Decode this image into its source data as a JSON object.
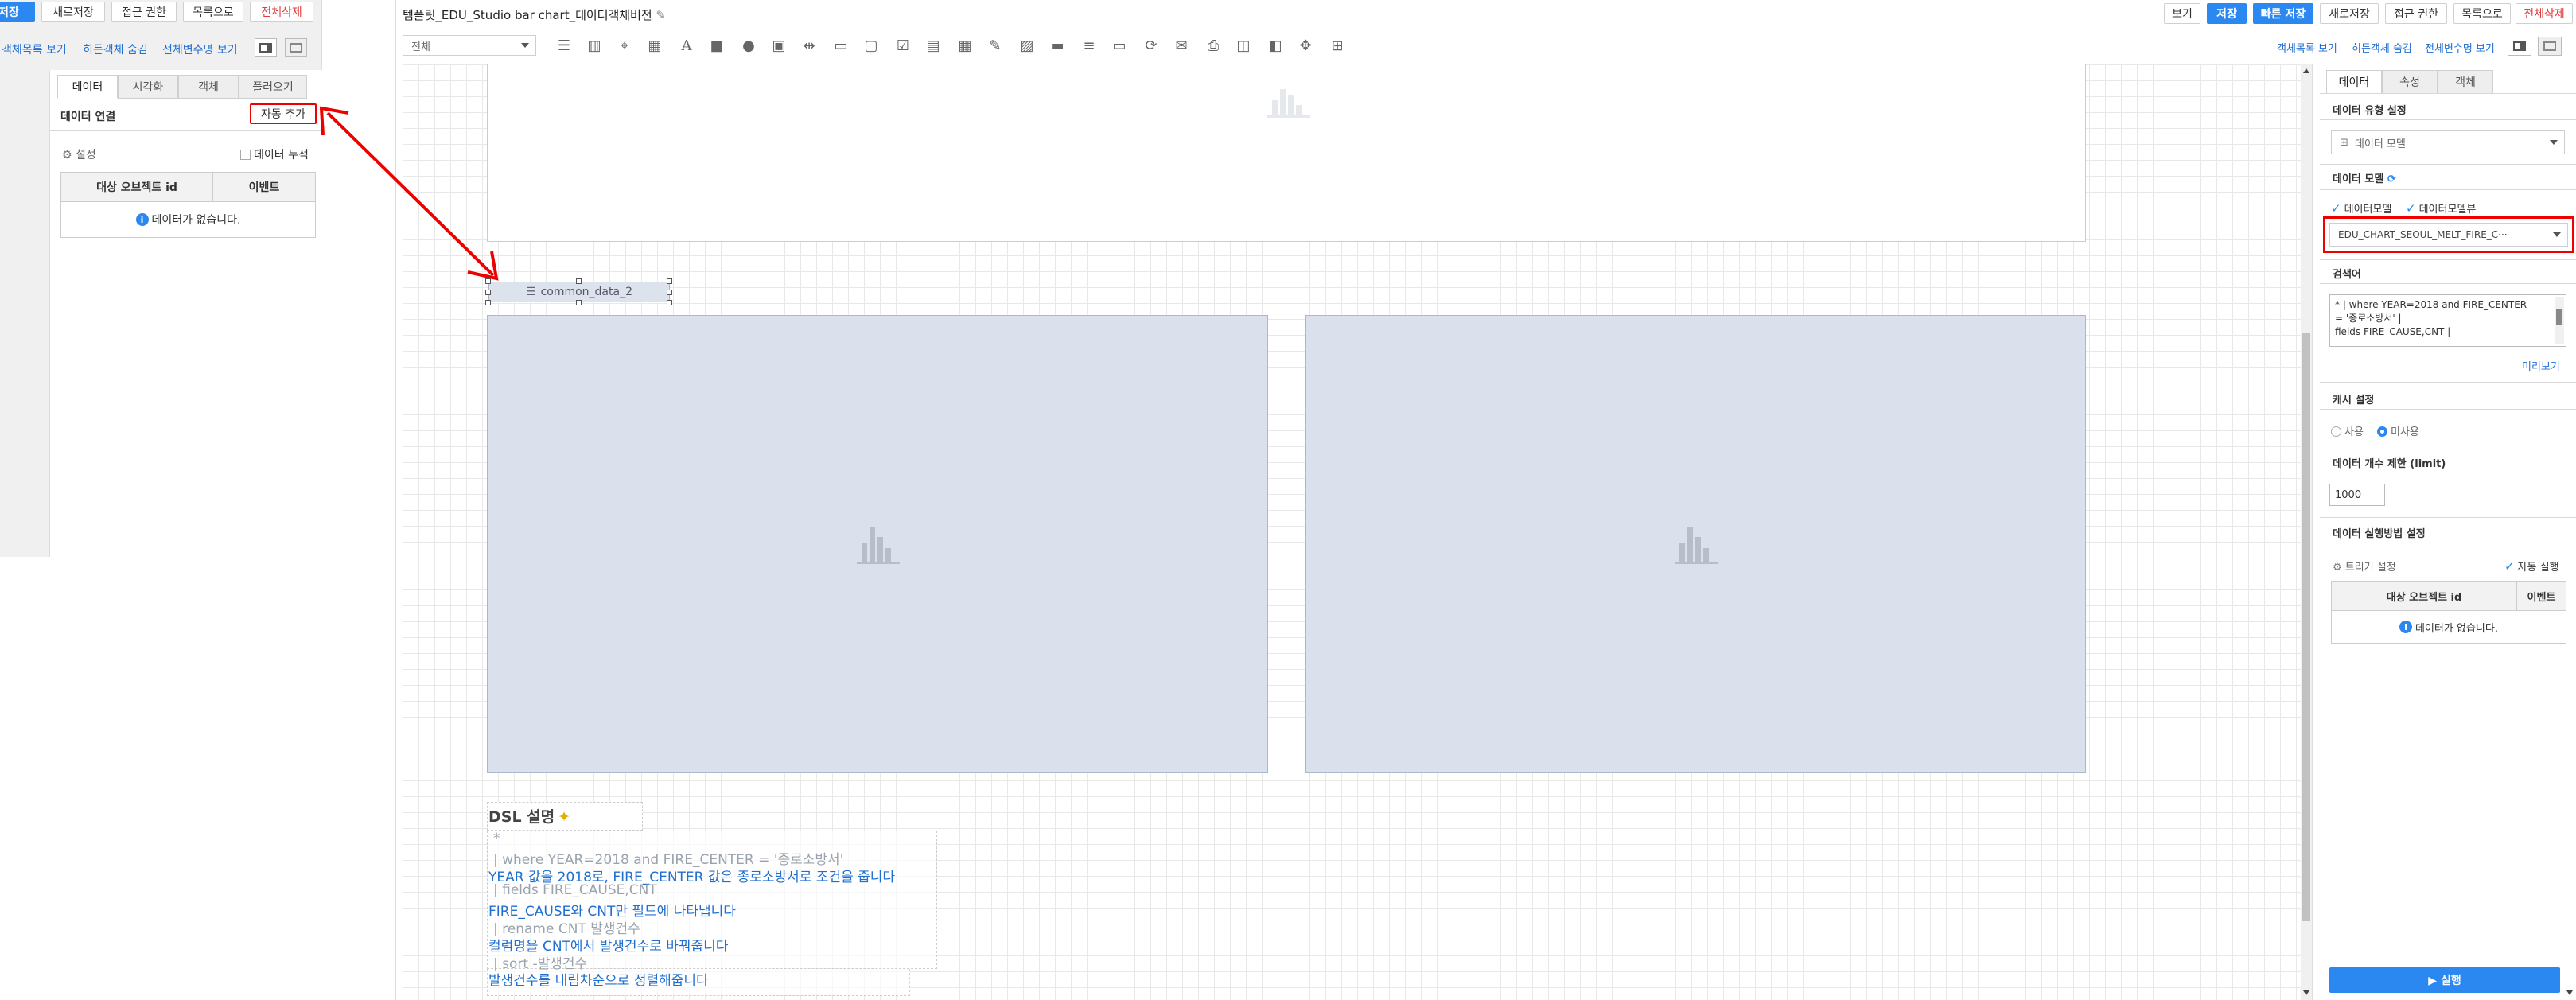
{
  "left_panel": {
    "toolbar": {
      "save_label": "저장",
      "save_as_label": "새로저장",
      "access_label": "접근 권한",
      "list_label": "목록으로",
      "delete_all_label": "전체삭제"
    },
    "links": {
      "object_list": "객체목록 보기",
      "hidden_objects": "히든객체 숨김",
      "all_vars": "전체변수명 보기"
    },
    "tabs": [
      "데이터",
      "시각화",
      "객체",
      "플러오기"
    ],
    "section_title": "데이터 연결",
    "auto_add_label": "자동 추가",
    "settings_label": "설정",
    "accumulate_label": "데이터 누적",
    "table": {
      "col1": "대상 오브젝트 id",
      "col2": "이벤트",
      "empty": "데이터가 없습니다."
    }
  },
  "header": {
    "title": "템플릿_EDU_Studio bar chart_데이터객체버전",
    "buttons": {
      "view": "보기",
      "save": "저장",
      "quick_save": "빠른 저장",
      "save_as": "새로저장",
      "access": "접근 권한",
      "list": "목록으로",
      "delete_all": "전체삭제"
    },
    "links": {
      "object_list": "객체목록 보기",
      "hidden_objects": "히든객체 숨김",
      "all_vars": "전체변수명 보기"
    },
    "filter_value": "전체"
  },
  "canvas": {
    "data_object_label": "common_data_2",
    "dsl": {
      "title": "DSL 설명",
      "lines": [
        {
          "text": "*",
          "style": "g"
        },
        {
          "text": "| where YEAR=2018 and FIRE_CENTER = '종로소방서'",
          "style": "g"
        },
        {
          "text": "YEAR 값을 2018로, FIRE_CENTER 값은 종로소방서로 조건을 줍니다",
          "style": "b"
        },
        {
          "text": "| fields FIRE_CAUSE,CNT",
          "style": "g"
        },
        {
          "text": "FIRE_CAUSE와 CNT만 필드에 나타냅니다",
          "style": "b"
        },
        {
          "text": "| rename CNT 발생건수",
          "style": "g"
        },
        {
          "text": "컬럼명을 CNT에서 발생건수로 바꿔줍니다",
          "style": "b"
        },
        {
          "text": "| sort -발생건수",
          "style": "g"
        },
        {
          "text": "발생건수를 내림차순으로 정렬해줍니다",
          "style": "b"
        }
      ]
    }
  },
  "right_panel": {
    "tabs": [
      "데이터",
      "속성",
      "객체"
    ],
    "data_type_title": "데이터 유형 설정",
    "data_type_value": "데이터 모델",
    "data_model_title": "데이터 모델",
    "checkbox_model": "데이터모델",
    "checkbox_view": "데이터모델뷰",
    "model_value": "EDU_CHART_SEOUL_MELT_FIRE_C···",
    "search_title": "검색어",
    "search_lines": [
      "* | where YEAR=2018 and FIRE_CENTER",
      "= '종로소방서' |",
      "fields FIRE_CAUSE,CNT |"
    ],
    "preview_label": "미리보기",
    "cache_title": "캐시 설정",
    "cache_use": "사용",
    "cache_nouse": "미사용",
    "limit_title": "데이터 개수 제한 (limit)",
    "limit_value": "1000",
    "exec_title": "데이터 실행방법 설정",
    "trigger_label": "트리거 설정",
    "auto_exec_label": "자동 실행",
    "table": {
      "col1": "대상 오브젝트 id",
      "col2": "이벤트",
      "empty": "데이터가 없습니다."
    },
    "run_label": "▶ 실행"
  }
}
